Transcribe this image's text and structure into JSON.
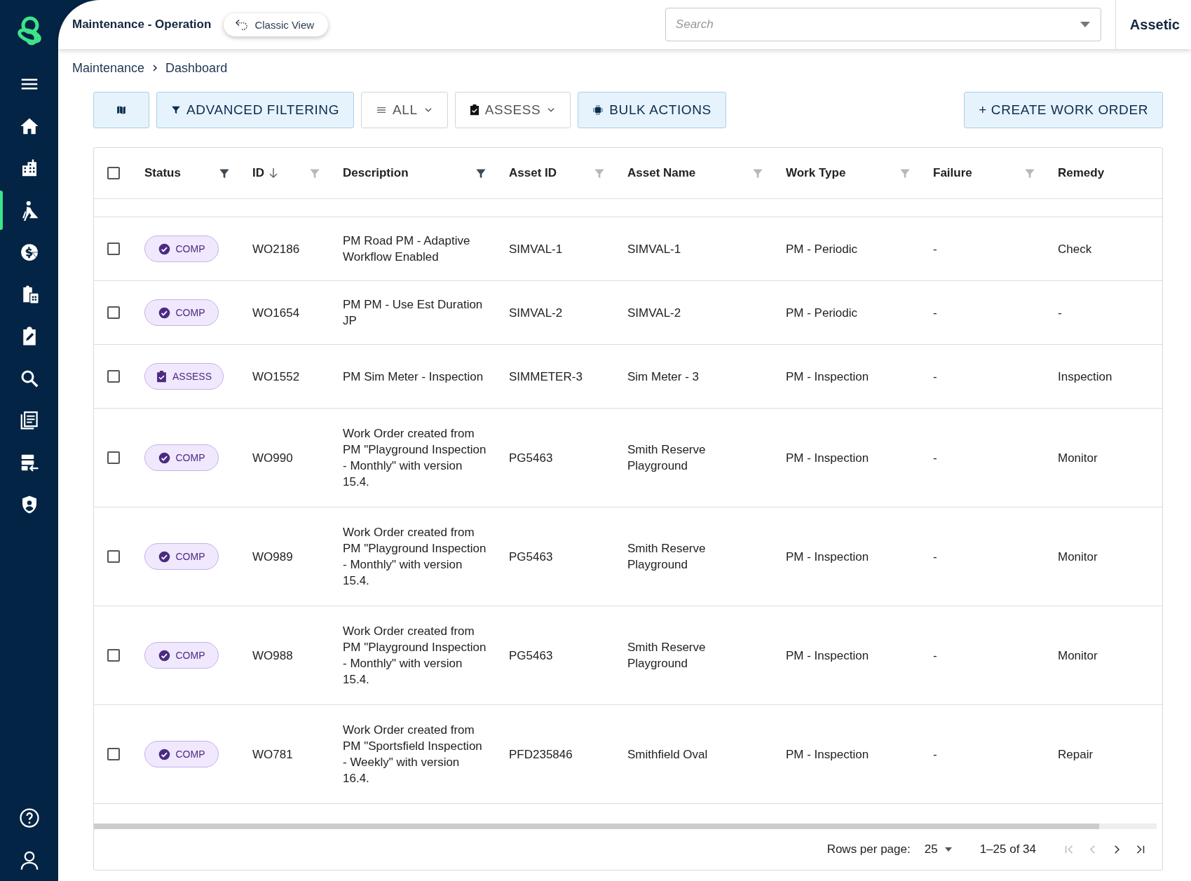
{
  "sidebar": {
    "items": [
      {
        "selected": false
      },
      {
        "selected": false
      },
      {
        "selected": false
      },
      {
        "selected": true
      },
      {
        "selected": false
      },
      {
        "selected": false
      },
      {
        "selected": false
      },
      {
        "selected": false
      },
      {
        "selected": false
      },
      {
        "selected": false
      },
      {
        "selected": false
      }
    ]
  },
  "header": {
    "title": "Maintenance - Operation",
    "classic_view": "Classic View",
    "search": {
      "placeholder": "Search"
    },
    "brand": "Assetic"
  },
  "breadcrumb": [
    "Maintenance",
    "Dashboard"
  ],
  "toolbar": [
    {
      "kind": "map",
      "highlight": true
    },
    {
      "kind": "filter",
      "label": "ADVANCED FILTERING",
      "highlight": true
    },
    {
      "kind": "view",
      "label": "ALL",
      "highlight": false
    },
    {
      "kind": "assess",
      "label": "ASSESS",
      "highlight": false
    },
    {
      "kind": "bulk",
      "label": "BULK ACTIONS",
      "highlight": true
    }
  ],
  "create_button": "+ CREATE WORK ORDER",
  "table": {
    "select_all": false,
    "columns": [
      {
        "label": "Status",
        "filter_active": true
      },
      {
        "label": "ID",
        "sorted": true,
        "filter_active": false
      },
      {
        "label": "Description",
        "filter_active": true
      },
      {
        "label": "Asset ID",
        "filter_active": false
      },
      {
        "label": "Asset Name",
        "filter_active": false
      },
      {
        "label": "Work Type",
        "filter_active": false
      },
      {
        "label": "Failure",
        "filter_active": false
      },
      {
        "label": "Remedy"
      }
    ],
    "rows": [
      {
        "checked": false,
        "status": {
          "kind": "comp",
          "label": "COMP"
        },
        "id": "WO2186",
        "description": "PM Road PM - Adaptive Workflow Enabled",
        "asset_id": "SIMVAL-1",
        "asset_name": "SIMVAL-1",
        "work_type": "PM - Periodic",
        "failure": "-",
        "remedy": "Check"
      },
      {
        "checked": false,
        "status": {
          "kind": "comp",
          "label": "COMP"
        },
        "id": "WO1654",
        "description": "PM PM - Use Est Duration JP",
        "asset_id": "SIMVAL-2",
        "asset_name": "SIMVAL-2",
        "work_type": "PM - Periodic",
        "failure": "-",
        "remedy": "-"
      },
      {
        "checked": false,
        "status": {
          "kind": "assess",
          "label": "ASSESS"
        },
        "id": "WO1552",
        "description": "PM Sim Meter - Inspection",
        "asset_id": "SIMMETER-3",
        "asset_name": "Sim Meter - 3",
        "work_type": "PM - Inspection",
        "failure": "-",
        "remedy": "Inspection"
      },
      {
        "checked": false,
        "status": {
          "kind": "comp",
          "label": "COMP"
        },
        "id": "WO990",
        "description": "Work Order created from PM \"Playground Inspection - Monthly\" with version 15.4.",
        "asset_id": "PG5463",
        "asset_name": "Smith Reserve Playground",
        "work_type": "PM - Inspection",
        "failure": "-",
        "remedy": "Monitor"
      },
      {
        "checked": false,
        "status": {
          "kind": "comp",
          "label": "COMP"
        },
        "id": "WO989",
        "description": "Work Order created from PM \"Playground Inspection - Monthly\" with version 15.4.",
        "asset_id": "PG5463",
        "asset_name": "Smith Reserve Playground",
        "work_type": "PM - Inspection",
        "failure": "-",
        "remedy": "Monitor"
      },
      {
        "checked": false,
        "status": {
          "kind": "comp",
          "label": "COMP"
        },
        "id": "WO988",
        "description": "Work Order created from PM \"Playground Inspection - Monthly\" with version 15.4.",
        "asset_id": "PG5463",
        "asset_name": "Smith Reserve Playground",
        "work_type": "PM - Inspection",
        "failure": "-",
        "remedy": "Monitor"
      },
      {
        "checked": false,
        "status": {
          "kind": "comp",
          "label": "COMP"
        },
        "id": "WO781",
        "description": "Work Order created from PM \"Sportsfield Inspection - Weekly\" with version 16.4.",
        "asset_id": "PFD235846",
        "asset_name": "Smithfield Oval",
        "work_type": "PM - Inspection",
        "failure": "-",
        "remedy": "Repair"
      }
    ]
  },
  "pagination": {
    "rows_per_page_label": "Rows per page:",
    "rows_per_page": "25",
    "range": "1–25 of 34",
    "first_disabled": true,
    "prev_disabled": true
  }
}
